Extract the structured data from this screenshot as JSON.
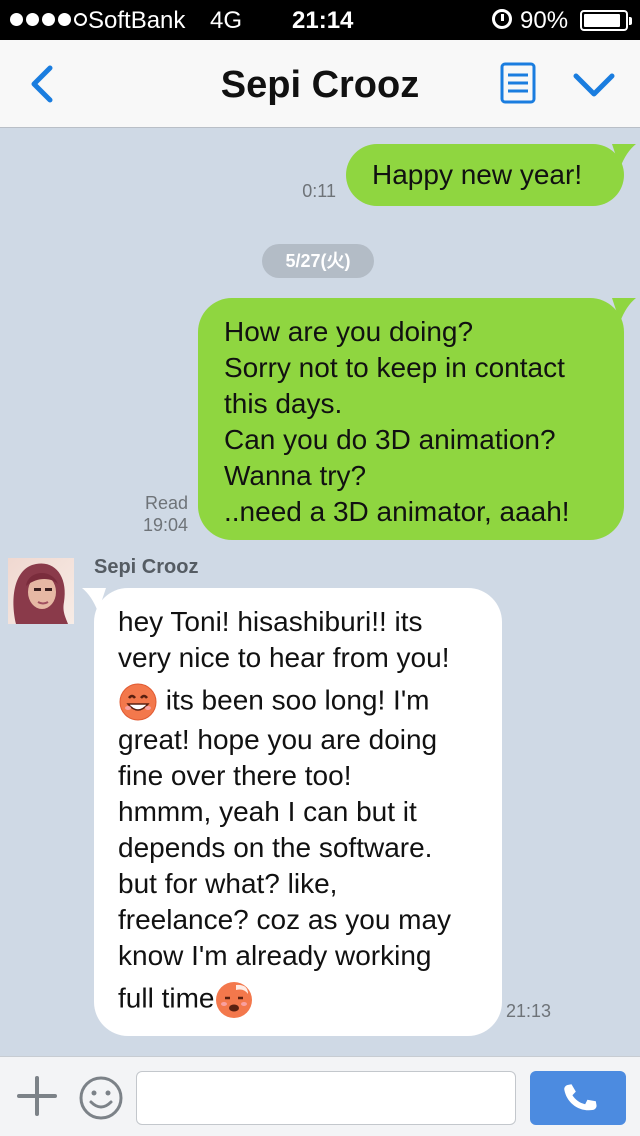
{
  "status_bar": {
    "carrier": "SoftBank",
    "network": "4G",
    "time": "21:14",
    "battery_pct": "90%",
    "battery_level": 0.9,
    "signal_bars": 4
  },
  "header": {
    "title": "Sepi Crooz",
    "back_icon": "chevron-left-icon",
    "notes_icon": "notes-icon",
    "menu_icon": "chevron-down-icon"
  },
  "messages": [
    {
      "direction": "out",
      "text": "Happy new year!",
      "time": "0:11"
    },
    {
      "type": "date",
      "text": "5/27(火)"
    },
    {
      "direction": "out",
      "lines": [
        "How are you doing?",
        "Sorry not to keep in contact",
        "this days.",
        "Can you do 3D animation?",
        "Wanna try?",
        "..need a 3D animator, aaah!"
      ],
      "read_label": "Read",
      "time": "19:04"
    },
    {
      "direction": "in",
      "sender": "Sepi Crooz",
      "lines": [
        "hey Toni! hisashiburi!! its",
        "very nice to hear from you!",
        " its been soo long! I'm",
        "great! hope you are doing",
        "fine over there too!",
        "hmmm, yeah I can but it",
        "depends on the software.",
        "but for what? like,",
        "freelance? coz as you may",
        "know I'm already working",
        "full time"
      ],
      "emojis": [
        "grinning-face-emoji",
        "dizzy-face-emoji"
      ],
      "time": "21:13"
    }
  ],
  "input_bar": {
    "placeholder": "",
    "plus_icon": "plus-icon",
    "sticker_icon": "smiley-icon",
    "call_icon": "phone-icon"
  },
  "colors": {
    "accent": "#1a7ddf",
    "outgoing_bubble": "#8fd640",
    "incoming_bubble": "#ffffff",
    "chat_background": "#cfd9e5",
    "call_button": "#4c8be0"
  }
}
